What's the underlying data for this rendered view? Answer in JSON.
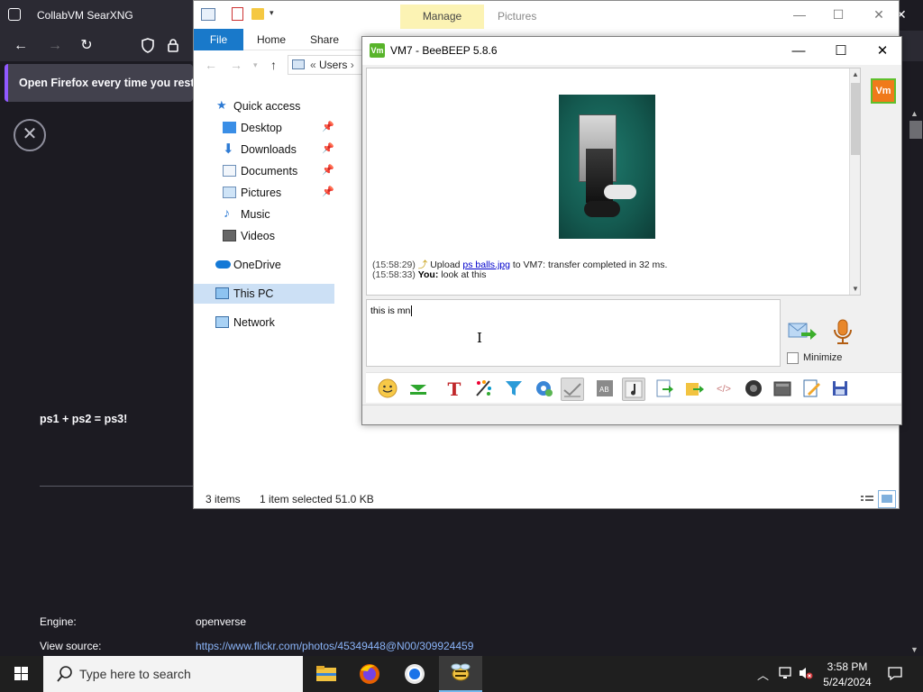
{
  "firefox": {
    "tab_title": "CollabVM SearXNG",
    "notice_text": "Open Firefox every time you restart",
    "page_heading": "ps1 + ps2 = ps3!",
    "engine_label": "Engine:",
    "engine_value": "openverse",
    "view_source_label": "View source:",
    "view_source_url": "https://www.flickr.com/photos/45349448@N00/309924459"
  },
  "explorer": {
    "manage_tab": "Manage",
    "pictures_tab": "Pictures",
    "ribbon_tabs": {
      "file": "File",
      "home": "Home",
      "share": "Share"
    },
    "address_path": "Users",
    "nav": {
      "quick_access": "Quick access",
      "desktop": "Desktop",
      "downloads": "Downloads",
      "documents": "Documents",
      "pictures": "Pictures",
      "music": "Music",
      "videos": "Videos",
      "onedrive": "OneDrive",
      "this_pc": "This PC",
      "network": "Network"
    },
    "status": {
      "items": "3 items",
      "selected": "1 item selected",
      "size": "51.0 KB"
    }
  },
  "beebeep": {
    "title": "VM7 - BeeBEEP 5.8.6",
    "avatar_label": "Vm",
    "chat": {
      "line1_time": "(15:58:29)",
      "line1_pre": "Upload",
      "line1_file": "ps balls.jpg",
      "line1_post": "to VM7: transfer completed in 32 ms.",
      "line2_time": "(15:58:33)",
      "line2_who": "You:",
      "line2_msg": "look at this"
    },
    "input_value": "this is mn",
    "minimize_label": "Minimize"
  },
  "taskbar": {
    "search_placeholder": "Type here to search",
    "time": "3:58 PM",
    "date": "5/24/2024"
  },
  "colors": {
    "firefox_bg": "#1c1b22",
    "explorer_file_tab": "#1979ca",
    "manage_tab_bg": "#fcf3b4",
    "beebeep_accent": "#58b42a",
    "taskbar_bg": "#1f1f1f"
  }
}
